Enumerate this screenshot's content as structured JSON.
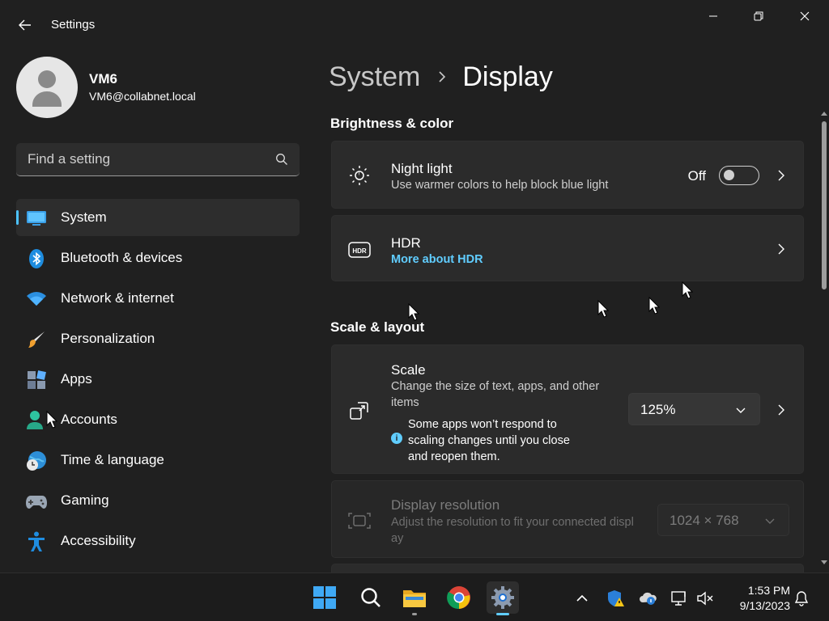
{
  "app": {
    "title": "Settings"
  },
  "profile": {
    "name": "VM6",
    "email": "VM6@collabnet.local"
  },
  "search": {
    "placeholder": "Find a setting"
  },
  "sidebar": {
    "items": [
      {
        "label": "System",
        "icon": "system-icon",
        "active": true
      },
      {
        "label": "Bluetooth & devices",
        "icon": "bluetooth-icon"
      },
      {
        "label": "Network & internet",
        "icon": "wifi-icon"
      },
      {
        "label": "Personalization",
        "icon": "brush-icon"
      },
      {
        "label": "Apps",
        "icon": "apps-icon"
      },
      {
        "label": "Accounts",
        "icon": "accounts-icon"
      },
      {
        "label": "Time & language",
        "icon": "globe-clock-icon"
      },
      {
        "label": "Gaming",
        "icon": "gamepad-icon"
      },
      {
        "label": "Accessibility",
        "icon": "accessibility-icon"
      }
    ]
  },
  "breadcrumb": {
    "parent": "System",
    "current": "Display"
  },
  "sections": {
    "brightness": {
      "title": "Brightness & color",
      "night_light": {
        "title": "Night light",
        "desc": "Use warmer colors to help block blue light",
        "state": "Off",
        "icon": "brightness-icon"
      },
      "hdr": {
        "title": "HDR",
        "link": "More about HDR",
        "icon": "hdr-icon"
      }
    },
    "scale_layout": {
      "title": "Scale & layout",
      "scale": {
        "title": "Scale",
        "desc": "Change the size of text, apps, and other items",
        "info": "Some apps won’t respond to scaling changes until you close and reopen them.",
        "value": "125%",
        "icon": "scale-icon"
      },
      "resolution": {
        "title": "Display resolution",
        "desc": "Adjust the resolution to fit your connected display",
        "value": "1024 × 768",
        "icon": "resolution-icon"
      }
    }
  },
  "taskbar": {
    "apps": [
      "start-icon",
      "search-icon",
      "file-explorer-icon",
      "chrome-icon",
      "settings-icon"
    ],
    "clock": {
      "time": "1:53 PM",
      "date": "9/13/2023"
    }
  },
  "colors": {
    "accent": "#60cdff",
    "background": "#202020",
    "card": "#2b2b2b"
  }
}
